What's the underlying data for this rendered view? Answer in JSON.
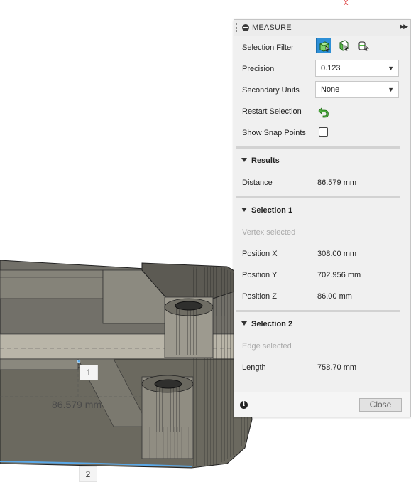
{
  "viewport": {
    "dimension_value": "86.579 mm",
    "point_markers": [
      "1",
      "2"
    ],
    "corner_glyph": "x"
  },
  "measure_panel": {
    "title": "MEASURE",
    "header_icons": [
      "collapse-icon",
      "expand-panel-icon"
    ],
    "selection_filter": {
      "label": "Selection Filter",
      "filters": [
        "body-filter-icon",
        "face-filter-icon",
        "edge-filter-icon"
      ],
      "active_filter": "body-filter-icon"
    },
    "precision": {
      "label": "Precision",
      "value": "0.123"
    },
    "secondary_units": {
      "label": "Secondary Units",
      "value": "None"
    },
    "restart_selection": {
      "label": "Restart Selection",
      "icon": "restart-arrow-icon"
    },
    "show_snap_points": {
      "label": "Show Snap Points",
      "checked": false
    },
    "results": {
      "title": "Results",
      "distance_label": "Distance",
      "distance_value": "86.579 mm"
    },
    "selection_1": {
      "title": "Selection 1",
      "status": "Vertex selected",
      "rows": [
        {
          "label": "Position X",
          "value": "308.00 mm"
        },
        {
          "label": "Position Y",
          "value": "702.956 mm"
        },
        {
          "label": "Position Z",
          "value": "86.00 mm"
        }
      ]
    },
    "selection_2": {
      "title": "Selection 2",
      "status": "Edge selected",
      "length_label": "Length",
      "length_value": "758.70 mm"
    },
    "footer": {
      "info_icon": "info-icon",
      "close_label": "Close"
    }
  },
  "colors": {
    "accent": "#2d8fd6",
    "restart_green": "#3e9a35",
    "model_fill": "#6d6b63",
    "model_lines": "#1e1e1e",
    "edge_highlight": "#5aa8e8",
    "corner_red": "#e05050"
  }
}
